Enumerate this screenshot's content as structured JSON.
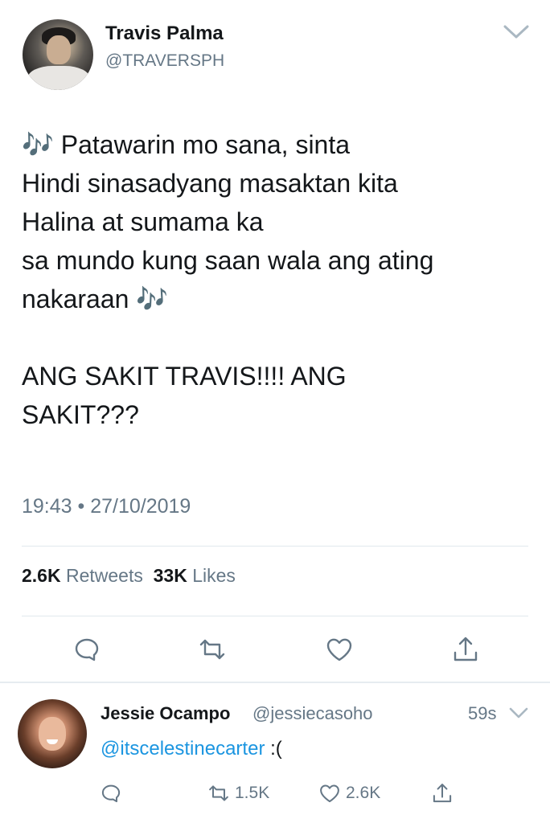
{
  "tweet": {
    "author_name": "Travis Palma",
    "author_handle": "@TRAVERSPH",
    "text": "🎶 Patawarin mo sana, sinta\nHindi sinasadyang masaktan kita\nHalina at sumama ka\nsa mundo kung saan wala ang ating\nnakaraan 🎶\n\nANG SAKIT TRAVIS!!!! ANG\nSAKIT???",
    "timestamp": "19:43 • 27/10/2019",
    "retweets_count": "2.6K",
    "retweets_label": "Retweets",
    "likes_count": "33K",
    "likes_label": "Likes"
  },
  "actions": [
    {
      "icon": "reply-icon"
    },
    {
      "icon": "retweet-icon"
    },
    {
      "icon": "like-icon"
    },
    {
      "icon": "share-icon"
    }
  ],
  "reply": {
    "author_name": "Jessie Ocampo",
    "author_handle": "@jessiecasoho",
    "time": "59s",
    "mention": "@itscelestinecarter",
    "text": " :(",
    "retweet_count": "1.5K",
    "like_count": "2.6K"
  },
  "colors": {
    "text": "#14171a",
    "secondary": "#657786",
    "link": "#1b95e0",
    "divider": "#e1e8ed"
  }
}
